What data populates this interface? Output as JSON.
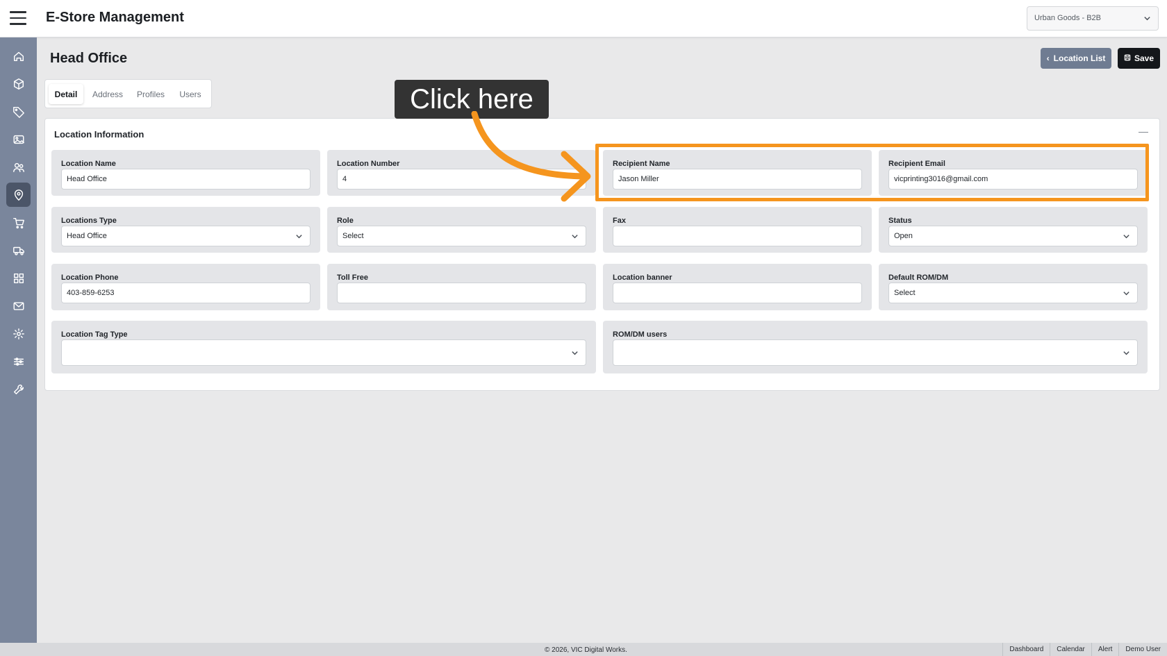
{
  "app": {
    "title": "E-Store Management",
    "store_selector": "Urban Goods - B2B"
  },
  "sidebar": {
    "items": [
      {
        "icon": "home-icon",
        "label": "Home"
      },
      {
        "icon": "box-icon",
        "label": "Products"
      },
      {
        "icon": "tag-icon",
        "label": "Tags"
      },
      {
        "icon": "image-icon",
        "label": "Images"
      },
      {
        "icon": "users-icon",
        "label": "Users"
      },
      {
        "icon": "location-pin-icon",
        "label": "Locations",
        "active": true
      },
      {
        "icon": "cart-icon",
        "label": "Orders"
      },
      {
        "icon": "truck-icon",
        "label": "Shipping"
      },
      {
        "icon": "grid-icon",
        "label": "Modules"
      },
      {
        "icon": "mail-icon",
        "label": "Messages"
      },
      {
        "icon": "gear-icon",
        "label": "Settings"
      },
      {
        "icon": "sliders-icon",
        "label": "Configuration"
      },
      {
        "icon": "wrench-icon",
        "label": "Tools"
      }
    ]
  },
  "page": {
    "title": "Head Office",
    "location_list_label": "Location List",
    "save_label": "Save"
  },
  "tabs": [
    "Detail",
    "Address",
    "Profiles",
    "Users"
  ],
  "card": {
    "title": "Location Information",
    "collapse_symbol": "—"
  },
  "fields": {
    "location_name": {
      "label": "Location Name",
      "value": "Head Office"
    },
    "location_number": {
      "label": "Location Number",
      "value": "4"
    },
    "recipient_name": {
      "label": "Recipient Name",
      "value": "Jason Miller"
    },
    "recipient_email": {
      "label": "Recipient Email",
      "value": "vicprinting3016@gmail.com"
    },
    "locations_type": {
      "label": "Locations Type",
      "value": "Head Office"
    },
    "role": {
      "label": "Role",
      "value": "Select"
    },
    "fax": {
      "label": "Fax",
      "value": ""
    },
    "status": {
      "label": "Status",
      "value": "Open"
    },
    "location_phone": {
      "label": "Location Phone",
      "value": "403-859-6253"
    },
    "toll_free": {
      "label": "Toll Free",
      "value": ""
    },
    "location_banner": {
      "label": "Location banner",
      "value": ""
    },
    "default_rom_dm": {
      "label": "Default ROM/DM",
      "value": "Select"
    },
    "location_tag_type": {
      "label": "Location Tag Type",
      "value": ""
    },
    "rom_dm_users": {
      "label": "ROM/DM users",
      "value": ""
    }
  },
  "overlay": {
    "tooltip_text": "Click here",
    "highlight_color": "#f5951e"
  },
  "footer": {
    "copyright": "© 2026, VIC Digital Works.",
    "links": [
      "Dashboard",
      "Calendar",
      "Alert",
      "Demo User"
    ]
  },
  "colors": {
    "sidebar_bg": "#7a869c",
    "sidebar_active": "#4b5568",
    "save_button": "#14171b",
    "list_button": "#6f7c92"
  }
}
